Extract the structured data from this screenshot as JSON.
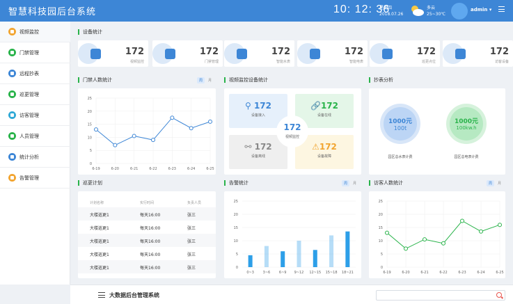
{
  "header": {
    "title": "智慧科技园后台系统",
    "clock": "10: 12: 36",
    "weekday": "星期四",
    "date": "2018.07.26",
    "weather": "多云",
    "temp": "25~30℃",
    "user": "admin ▾"
  },
  "sidebar": {
    "items": [
      {
        "label": "视频监控",
        "color": "#f2a531"
      },
      {
        "label": "门禁管理",
        "color": "#29b34a"
      },
      {
        "label": "远程抄表",
        "color": "#3d86d6"
      },
      {
        "label": "巡更管理",
        "color": "#29b34a"
      },
      {
        "label": "访客管理",
        "color": "#31a9d6"
      },
      {
        "label": "人员管理",
        "color": "#29b34a"
      },
      {
        "label": "统计分析",
        "color": "#3d86d6"
      },
      {
        "label": "告警管理",
        "color": "#f2a531"
      }
    ]
  },
  "sections": {
    "device_stats": "设备统计",
    "access_count": "门禁人数统计",
    "video_devices": "视频监控设备统计",
    "meter": "抄表分析",
    "patrol": "巡更计划",
    "alarm": "告警统计",
    "visitor": "访客人数统计"
  },
  "toggles": {
    "week": "周",
    "month": "月"
  },
  "device_stats": [
    {
      "value": "172",
      "label": "视频监控",
      "color": "#3d86d6",
      "icon": "camera-ai-icon"
    },
    {
      "value": "172",
      "label": "门禁管理",
      "color": "#3d86d6",
      "icon": "door-icon"
    },
    {
      "value": "172",
      "label": "智能水表",
      "color": "#3d86d6",
      "icon": "water-meter-icon"
    },
    {
      "value": "172",
      "label": "智能电表",
      "color": "#3d86d6",
      "icon": "electric-meter-icon"
    },
    {
      "value": "172",
      "label": "巡更点位",
      "color": "#3d86d6",
      "icon": "patrol-point-icon"
    },
    {
      "value": "172",
      "label": "访客设备",
      "color": "#3d86d6",
      "icon": "visitor-device-icon"
    }
  ],
  "video_stats": {
    "access": {
      "value": "172",
      "label": "设备接入"
    },
    "online": {
      "value": "172",
      "label": "设备在线"
    },
    "offline": {
      "value": "172",
      "label": "设备离线"
    },
    "fault": {
      "value": "172",
      "label": "设备故障"
    },
    "center": {
      "value": "172",
      "label": "视频监控"
    }
  },
  "meter": {
    "water": {
      "value": "1000元",
      "unit": "100t",
      "label": "园区总水表计费"
    },
    "power": {
      "value": "1000元",
      "unit": "100kw.h",
      "label": "园区总电表计费"
    }
  },
  "patrol_table": {
    "headers": [
      "计划名称",
      "实行时间",
      "负责人员"
    ],
    "rows": [
      [
        "大楼巡更1",
        "每天16:00",
        "张三"
      ],
      [
        "大楼巡更1",
        "每天16:00",
        "张三"
      ],
      [
        "大楼巡更1",
        "每天16:00",
        "张三"
      ],
      [
        "大楼巡更1",
        "每天16:00",
        "张三"
      ],
      [
        "大楼巡更1",
        "每天16:00",
        "张三"
      ]
    ]
  },
  "footer": {
    "title": "大数据后台管理系统",
    "search_placeholder": ""
  },
  "chart_data": [
    {
      "type": "line",
      "categories": [
        "6-19",
        "6-20",
        "6-21",
        "6-22",
        "6-23",
        "6-24",
        "6-25"
      ],
      "values": [
        13,
        7,
        10.5,
        9,
        17.5,
        13.5,
        16
      ],
      "ylim": [
        0,
        25
      ],
      "yticks": [
        0,
        5,
        10,
        15,
        20,
        25
      ],
      "color": "#3d86d6"
    },
    {
      "type": "bar",
      "categories": [
        "0~3",
        "3~6",
        "6~9",
        "9~12",
        "12~15",
        "15~18",
        "18~21"
      ],
      "values": [
        4.5,
        8,
        6,
        10,
        6.5,
        12,
        13.5
      ],
      "ylim": [
        0,
        25
      ],
      "yticks": [
        0,
        5,
        10,
        15,
        20,
        25
      ],
      "color": "#2d9fe8"
    },
    {
      "type": "line",
      "categories": [
        "6-19",
        "6-20",
        "6-21",
        "6-22",
        "6-23",
        "6-24",
        "6-25"
      ],
      "values": [
        13,
        7,
        10.5,
        9,
        17.5,
        13.5,
        16
      ],
      "ylim": [
        0,
        25
      ],
      "yticks": [
        0,
        5,
        10,
        15,
        20,
        25
      ],
      "color": "#29b34a"
    }
  ]
}
